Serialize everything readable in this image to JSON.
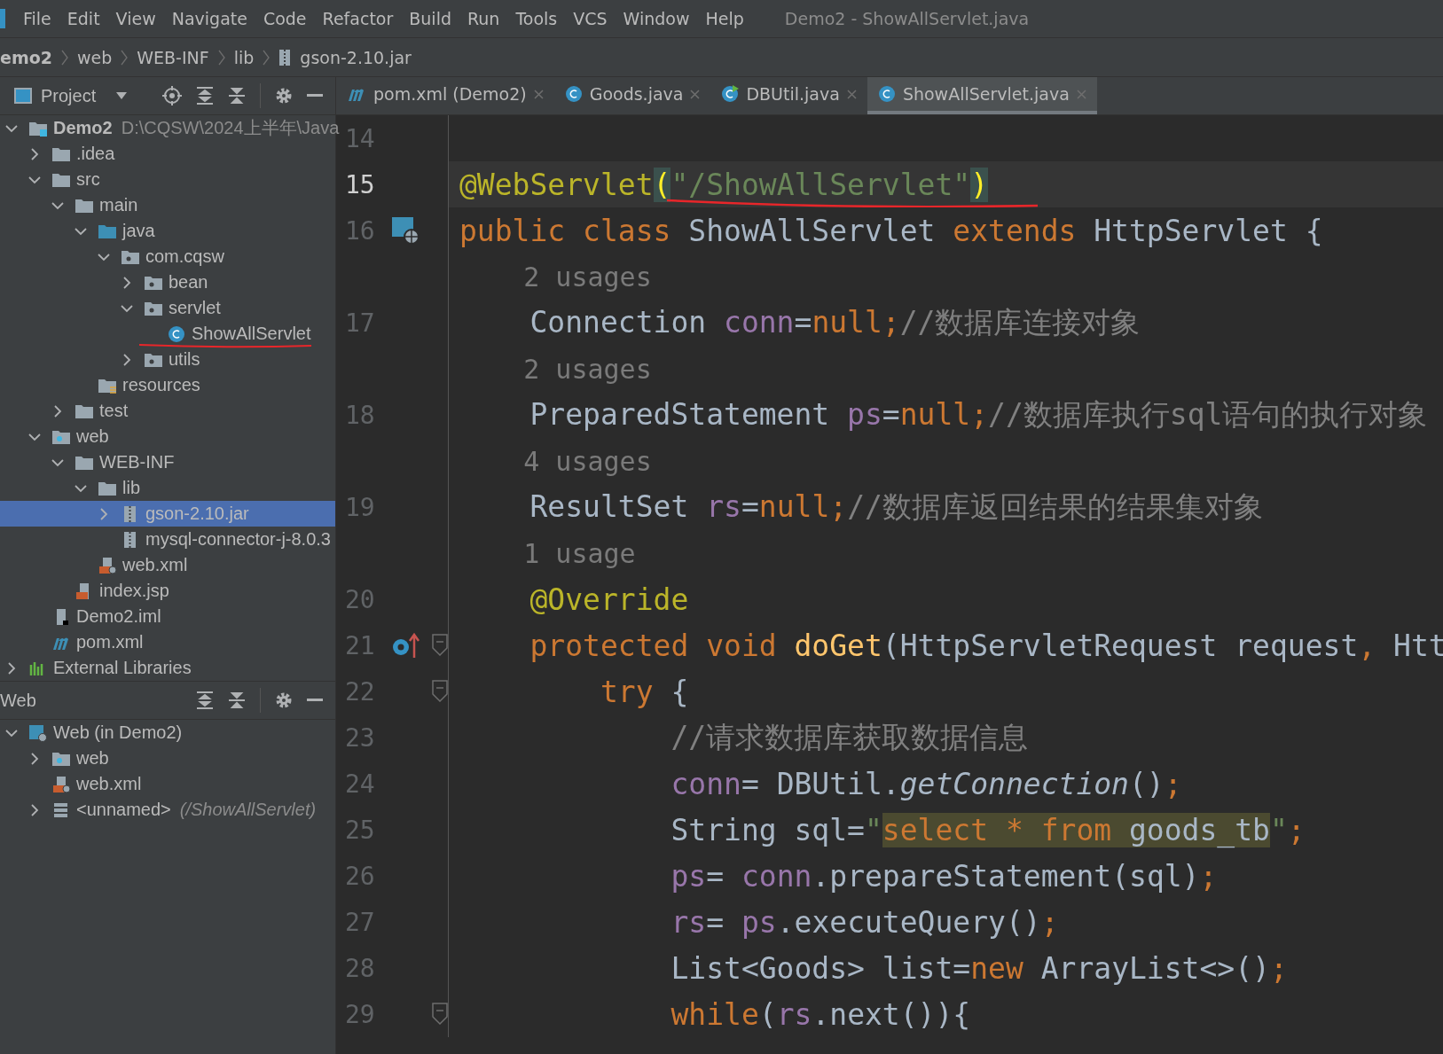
{
  "menu_bar": {
    "items": [
      "File",
      "Edit",
      "View",
      "Navigate",
      "Code",
      "Refactor",
      "Build",
      "Run",
      "Tools",
      "VCS",
      "Window",
      "Help"
    ],
    "title": "Demo2 - ShowAllServlet.java"
  },
  "breadcrumb": [
    {
      "label": "emo2",
      "kind": "module"
    },
    {
      "label": "web",
      "kind": "plain"
    },
    {
      "label": "WEB-INF",
      "kind": "plain"
    },
    {
      "label": "lib",
      "kind": "plain"
    },
    {
      "label": "gson-2.10.jar",
      "kind": "jar"
    }
  ],
  "project_panel": {
    "title": "Project",
    "tree": [
      {
        "label": "Demo2",
        "path": "D:\\CQSW\\2024上半年\\Java",
        "kind": "module",
        "expanded": true,
        "selected": false,
        "children": [
          {
            "label": ".idea",
            "kind": "folder",
            "expanded": false,
            "selected": false
          },
          {
            "label": "src",
            "kind": "folder",
            "expanded": true,
            "selected": false,
            "children": [
              {
                "label": "main",
                "kind": "folder",
                "expanded": true,
                "selected": false,
                "children": [
                  {
                    "label": "java",
                    "kind": "source-folder",
                    "expanded": true,
                    "selected": false,
                    "children": [
                      {
                        "label": "com.cqsw",
                        "kind": "package",
                        "expanded": true,
                        "selected": false,
                        "children": [
                          {
                            "label": "bean",
                            "kind": "package",
                            "expanded": false,
                            "selected": false
                          },
                          {
                            "label": "servlet",
                            "kind": "package",
                            "expanded": true,
                            "selected": false,
                            "children": [
                              {
                                "label": "ShowAllServlet",
                                "kind": "class",
                                "selected": false,
                                "underlined": true
                              }
                            ]
                          },
                          {
                            "label": "utils",
                            "kind": "package",
                            "expanded": false,
                            "selected": false
                          }
                        ]
                      }
                    ]
                  },
                  {
                    "label": "resources",
                    "kind": "resources-folder",
                    "selected": false
                  }
                ]
              },
              {
                "label": "test",
                "kind": "folder",
                "expanded": false,
                "selected": false
              }
            ]
          },
          {
            "label": "web",
            "kind": "web-folder",
            "expanded": true,
            "selected": false,
            "children": [
              {
                "label": "WEB-INF",
                "kind": "folder",
                "expanded": true,
                "selected": false,
                "children": [
                  {
                    "label": "lib",
                    "kind": "folder",
                    "expanded": true,
                    "selected": false,
                    "children": [
                      {
                        "label": "gson-2.10.jar",
                        "kind": "jar",
                        "expanded": false,
                        "selected": true
                      },
                      {
                        "label": "mysql-connector-j-8.0.3",
                        "kind": "jar",
                        "selected": false
                      }
                    ]
                  },
                  {
                    "label": "web.xml",
                    "kind": "webxml",
                    "selected": false
                  }
                ]
              },
              {
                "label": "index.jsp",
                "kind": "jsp",
                "selected": false
              }
            ]
          },
          {
            "label": "Demo2.iml",
            "kind": "iml",
            "selected": false
          },
          {
            "label": "pom.xml",
            "kind": "maven",
            "selected": false
          }
        ]
      },
      {
        "label": "External Libraries",
        "kind": "libraries",
        "expanded": false,
        "selected": false
      }
    ]
  },
  "web_panel": {
    "title": "Web",
    "tree": [
      {
        "label": "Web (in Demo2)",
        "kind": "web-facet",
        "expanded": true,
        "selected": false,
        "children": [
          {
            "label": "web",
            "kind": "web-folder",
            "expanded": false,
            "selected": false
          },
          {
            "label": "web.xml",
            "kind": "webxml",
            "selected": false
          },
          {
            "label": "<unnamed>",
            "hint": "(/ShowAllServlet)",
            "kind": "servlet",
            "expanded": false,
            "selected": false
          }
        ]
      }
    ]
  },
  "tabs": [
    {
      "label": "pom.xml (Demo2)",
      "kind": "maven",
      "selected": false
    },
    {
      "label": "Goods.java",
      "kind": "class",
      "selected": false
    },
    {
      "label": "DBUtil.java",
      "kind": "class-run",
      "selected": false
    },
    {
      "label": "ShowAllServlet.java",
      "kind": "class",
      "selected": true
    }
  ],
  "editor": {
    "lines": [
      {
        "kind": "code",
        "number": "14"
      },
      {
        "kind": "code",
        "number": "15",
        "current": true,
        "underlined": true,
        "tokens": [
          {
            "text": "@WebServlet",
            "kind": "annotation"
          },
          {
            "text": "(",
            "kind": "bracket-match"
          },
          {
            "text": "\"/ShowAllServlet\"",
            "kind": "string"
          },
          {
            "text": ")",
            "kind": "bracket-match"
          }
        ]
      },
      {
        "kind": "code",
        "number": "16",
        "gutter": {
          "kind": "servlet"
        },
        "tokens": [
          {
            "text": "public class ",
            "kind": "keyword"
          },
          {
            "text": "ShowAllServlet ",
            "kind": "plain"
          },
          {
            "text": "extends ",
            "kind": "keyword"
          },
          {
            "text": "HttpServlet {",
            "kind": "plain"
          }
        ]
      },
      {
        "kind": "hint",
        "text": "    2 usages"
      },
      {
        "kind": "code",
        "number": "17",
        "tokens": [
          {
            "text": "    Connection ",
            "kind": "plain"
          },
          {
            "text": "conn",
            "kind": "field"
          },
          {
            "text": "=",
            "kind": "plain"
          },
          {
            "text": "null;",
            "kind": "keyword"
          },
          {
            "text": "//数据库连接对象",
            "kind": "comment"
          }
        ]
      },
      {
        "kind": "hint",
        "text": "    2 usages"
      },
      {
        "kind": "code",
        "number": "18",
        "tokens": [
          {
            "text": "    PreparedStatement ",
            "kind": "plain"
          },
          {
            "text": "ps",
            "kind": "field"
          },
          {
            "text": "=",
            "kind": "plain"
          },
          {
            "text": "null;",
            "kind": "keyword"
          },
          {
            "text": "//数据库执行sql语句的执行对象",
            "kind": "comment"
          }
        ]
      },
      {
        "kind": "hint",
        "text": "    4 usages"
      },
      {
        "kind": "code",
        "number": "19",
        "tokens": [
          {
            "text": "    ResultSet ",
            "kind": "plain"
          },
          {
            "text": "rs",
            "kind": "field"
          },
          {
            "text": "=",
            "kind": "plain"
          },
          {
            "text": "null;",
            "kind": "keyword"
          },
          {
            "text": "//数据库返回结果的结果集对象",
            "kind": "comment"
          }
        ]
      },
      {
        "kind": "hint",
        "text": "    1 usage"
      },
      {
        "kind": "code",
        "number": "20",
        "tokens": [
          {
            "text": "    @Override",
            "kind": "annotation"
          }
        ]
      },
      {
        "kind": "code",
        "number": "21",
        "gutter": {
          "kind": "override"
        },
        "fold": true,
        "tokens": [
          {
            "text": "    protected void ",
            "kind": "keyword"
          },
          {
            "text": "doGet",
            "kind": "method-decl"
          },
          {
            "text": "(HttpServletRequest request",
            "kind": "plain"
          },
          {
            "text": ", ",
            "kind": "keyword"
          },
          {
            "text": "Htt",
            "kind": "plain"
          }
        ]
      },
      {
        "kind": "code",
        "number": "22",
        "fold": true,
        "tokens": [
          {
            "text": "        try ",
            "kind": "keyword"
          },
          {
            "text": "{",
            "kind": "plain"
          }
        ]
      },
      {
        "kind": "code",
        "number": "23",
        "tokens": [
          {
            "text": "            //请求数据库获取数据信息",
            "kind": "comment"
          }
        ]
      },
      {
        "kind": "code",
        "number": "24",
        "tokens": [
          {
            "text": "            conn",
            "kind": "field"
          },
          {
            "text": "= DBUtil.",
            "kind": "plain"
          },
          {
            "text": "getConnection",
            "kind": "static-call"
          },
          {
            "text": "()",
            "kind": "plain"
          },
          {
            "text": ";",
            "kind": "keyword"
          }
        ]
      },
      {
        "kind": "code",
        "number": "25",
        "tokens": [
          {
            "text": "            String sql=",
            "kind": "plain"
          },
          {
            "text": "\"",
            "kind": "string"
          },
          {
            "text": "select * from ",
            "kind": "sql-keyword"
          },
          {
            "text": "goods_tb",
            "kind": "sql-text"
          },
          {
            "text": "\"",
            "kind": "string"
          },
          {
            "text": ";",
            "kind": "keyword"
          }
        ]
      },
      {
        "kind": "code",
        "number": "26",
        "tokens": [
          {
            "text": "            ps",
            "kind": "field"
          },
          {
            "text": "= ",
            "kind": "plain"
          },
          {
            "text": "conn",
            "kind": "field"
          },
          {
            "text": ".prepareStatement(sql)",
            "kind": "plain"
          },
          {
            "text": ";",
            "kind": "keyword"
          }
        ]
      },
      {
        "kind": "code",
        "number": "27",
        "tokens": [
          {
            "text": "            rs",
            "kind": "field"
          },
          {
            "text": "= ",
            "kind": "plain"
          },
          {
            "text": "ps",
            "kind": "field"
          },
          {
            "text": ".executeQuery()",
            "kind": "plain"
          },
          {
            "text": ";",
            "kind": "keyword"
          }
        ]
      },
      {
        "kind": "code",
        "number": "28",
        "tokens": [
          {
            "text": "            List<Goods> list=",
            "kind": "plain"
          },
          {
            "text": "new ",
            "kind": "keyword"
          },
          {
            "text": "ArrayList<>()",
            "kind": "plain"
          },
          {
            "text": ";",
            "kind": "keyword"
          }
        ]
      },
      {
        "kind": "code",
        "number": "29",
        "fold": true,
        "tokens": [
          {
            "text": "            while",
            "kind": "keyword"
          },
          {
            "text": "(",
            "kind": "plain"
          },
          {
            "text": "rs",
            "kind": "field"
          },
          {
            "text": ".next()){",
            "kind": "plain"
          }
        ]
      }
    ]
  }
}
